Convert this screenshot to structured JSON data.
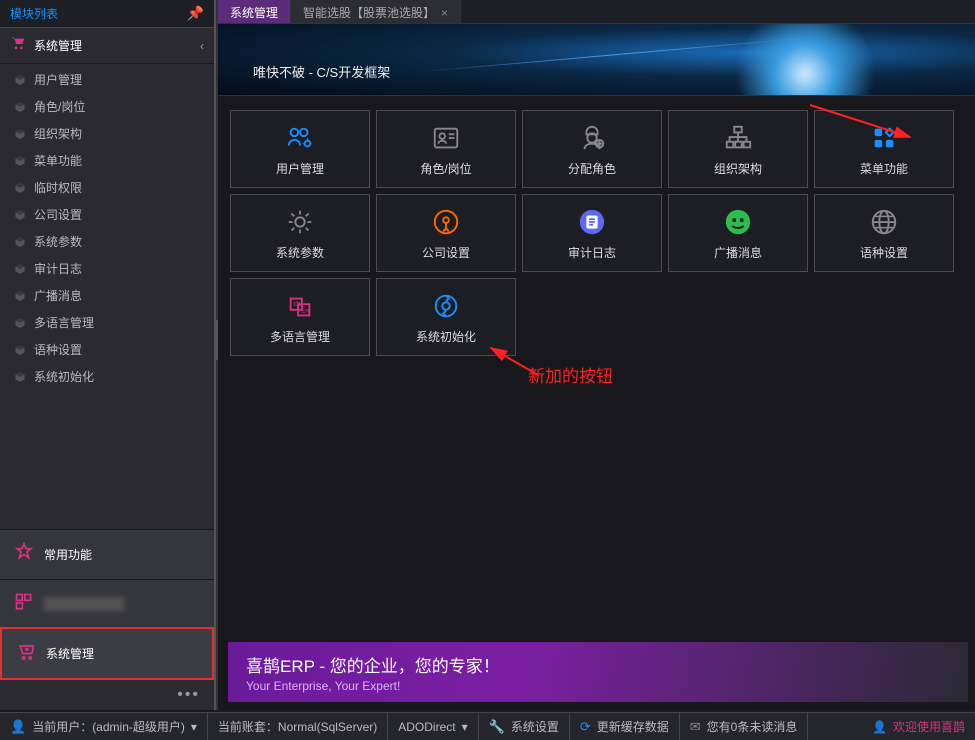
{
  "sidebar": {
    "header": "模块列表",
    "module_title": "系统管理",
    "items": [
      {
        "label": "用户管理"
      },
      {
        "label": "角色/岗位"
      },
      {
        "label": "组织架构"
      },
      {
        "label": "菜单功能"
      },
      {
        "label": "临时权限"
      },
      {
        "label": "公司设置"
      },
      {
        "label": "系统参数"
      },
      {
        "label": "审计日志"
      },
      {
        "label": "广播消息"
      },
      {
        "label": "多语言管理"
      },
      {
        "label": "语种设置"
      },
      {
        "label": "系统初始化"
      }
    ],
    "quick_star": "常用功能",
    "quick_mgmt": "系统管理"
  },
  "tabs": [
    {
      "label": "系统管理",
      "active": true
    },
    {
      "label": "智能选股【股票池选股】",
      "active": false
    }
  ],
  "banner": {
    "text": "唯快不破 - C/S开发框架"
  },
  "tiles": [
    {
      "label": "用户管理",
      "icon": "users",
      "color": "#1890ff"
    },
    {
      "label": "角色/岗位",
      "icon": "id-card",
      "color": "#888"
    },
    {
      "label": "分配角色",
      "icon": "agent",
      "color": "#888"
    },
    {
      "label": "组织架构",
      "icon": "org",
      "color": "#888"
    },
    {
      "label": "菜单功能",
      "icon": "grid",
      "color": "#1890ff"
    },
    {
      "label": "系统参数",
      "icon": "gear",
      "color": "#888"
    },
    {
      "label": "公司设置",
      "icon": "company",
      "color": "#ff6a00"
    },
    {
      "label": "审计日志",
      "icon": "audit",
      "color": "#5b6af0"
    },
    {
      "label": "广播消息",
      "icon": "broadcast",
      "color": "#2dbd4e"
    },
    {
      "label": "语种设置",
      "icon": "globe",
      "color": "#888"
    },
    {
      "label": "多语言管理",
      "icon": "lang",
      "color": "#d63384"
    },
    {
      "label": "系统初始化",
      "icon": "init",
      "color": "#1890ff"
    }
  ],
  "annotation": "新加的按钮",
  "footer": {
    "big": "喜鹊ERP - 您的企业，您的专家！",
    "small": "Your Enterprise, Your Expert!"
  },
  "status": {
    "user": "当前用户：(admin-超级用户)",
    "account": "当前账套：Normal(SqlServer)",
    "db": "ADODirect",
    "settings": "系统设置",
    "cache": "更新缓存数据",
    "unread": "您有0条未读消息",
    "welcome": "欢迎使用喜鹊"
  }
}
